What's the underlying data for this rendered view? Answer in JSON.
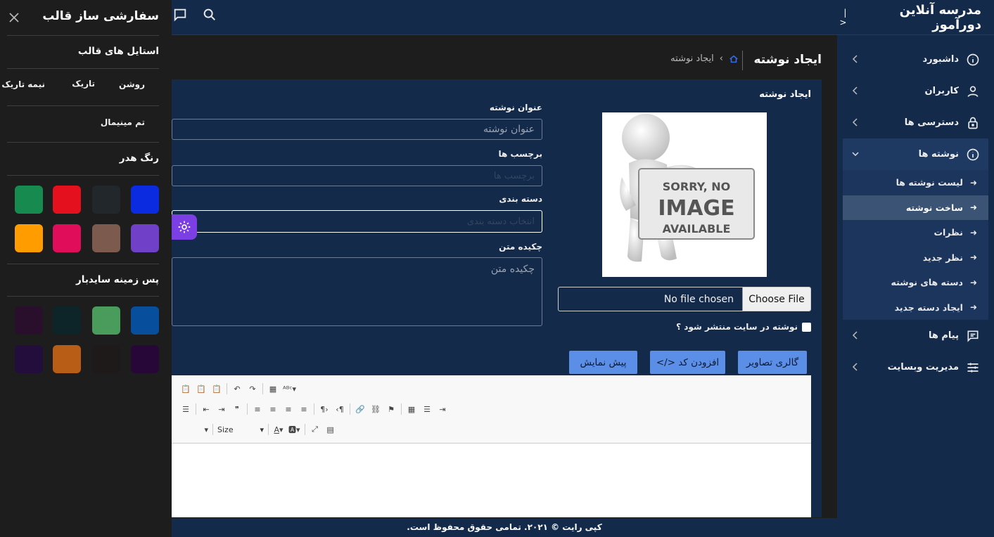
{
  "brand": {
    "title": "مدرسه آنلاین دورآموز",
    "collapse_glyph": "|<"
  },
  "sidebar": {
    "items": [
      {
        "label": "داشبورد",
        "icon": "info-icon"
      },
      {
        "label": "کاربران",
        "icon": "user-icon"
      },
      {
        "label": "دسترسی ها",
        "icon": "lock-icon"
      },
      {
        "label": "نوشته ها",
        "icon": "info-icon",
        "open": true
      },
      {
        "label": "پیام ها",
        "icon": "message-icon"
      },
      {
        "label": "مدیریت وبسایت",
        "icon": "sliders-icon"
      }
    ],
    "submenu": [
      "لیست نوشته ها",
      "ساخت نوشته",
      "نظرات",
      "نظر جدید",
      "دسته های نوشته",
      "ایجاد دسته جدید"
    ],
    "active_sub": "ساخت نوشته"
  },
  "page": {
    "title": "ایجاد نوشته",
    "breadcrumb_current": "ایجاد نوشته"
  },
  "form": {
    "card_title": "ایجاد نوشته",
    "image_text": {
      "line1": "SORRY, NO",
      "line2": "IMAGE",
      "line3": "AVAILABLE"
    },
    "file": {
      "button": "Choose File",
      "status": "No file chosen"
    },
    "publish_label": "نوشته در سایت منتشر شود ؟",
    "title_label": "عنوان نوشته",
    "title_placeholder": "عنوان نوشته",
    "tags_label": "برچسب ها",
    "tags_placeholder": "برچسب ها",
    "category_label": "دسته بندی",
    "category_placeholder": "انتخاب دسته بندی",
    "summary_label": "چکیده متن",
    "summary_placeholder": "چکیده متن",
    "buttons": {
      "gallery": "گالری تصاویر",
      "add_code": "افزودن کد </>",
      "preview": "پیش نمایش"
    },
    "editor": {
      "size_label": "Size"
    }
  },
  "footer": {
    "text": "کپی رایت © ۲۰۲۱. تمامی حقوق محفوظ است."
  },
  "customizer": {
    "title": "سفارشی ساز قالب",
    "styles_title": "استایل های قالب",
    "style_options": [
      "روشن",
      "تاریک",
      "نیمه تاریک"
    ],
    "minimal_option": "تم مینیمال",
    "header_color_title": "رنگ هدر",
    "header_colors": [
      "#0a2bdf",
      "#22272b",
      "#e5101e",
      "#178b4f",
      "#7140c8",
      "#7d5a4e",
      "#e00e5a",
      "#ff9d00"
    ],
    "sidebar_bg_title": "پس زمینه سایدبار",
    "sidebar_colors": [
      "#074e9c",
      "#4a9c5c",
      "#0d2428",
      "#2a0f2d",
      "#260738",
      "#1e1a1a",
      "#b85d15",
      "#220d3d"
    ]
  },
  "colors": {
    "header": "#142a4b",
    "accent": "#5b8ee6",
    "gear": "#7b3fe4"
  }
}
